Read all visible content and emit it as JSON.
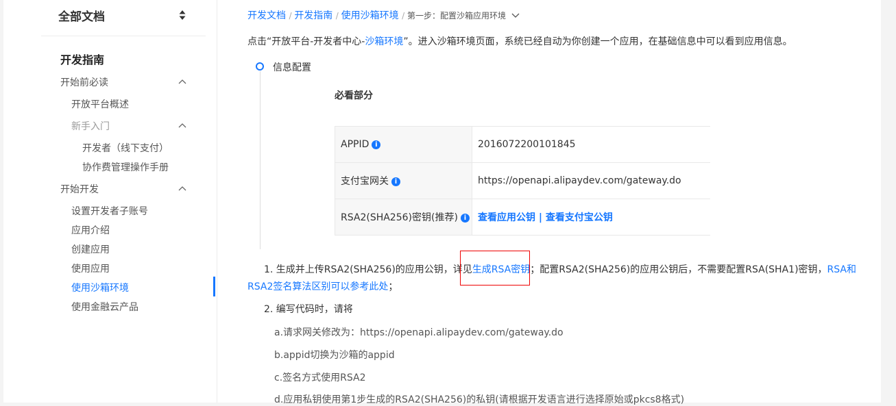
{
  "sidebar": {
    "header_title": "全部文档",
    "section_title": "开发指南",
    "items": [
      {
        "label": "开始前必读"
      },
      {
        "label": "开放平台概述"
      },
      {
        "label": "新手入门"
      },
      {
        "label": "开发者（线下支付）"
      },
      {
        "label": "协作费管理操作手册"
      },
      {
        "label": "开始开发"
      },
      {
        "label": "设置开发者子账号"
      },
      {
        "label": "应用介绍"
      },
      {
        "label": "创建应用"
      },
      {
        "label": "使用应用"
      },
      {
        "label": "使用沙箱环境"
      },
      {
        "label": "使用金融云产品"
      }
    ]
  },
  "breadcrumb": {
    "items": [
      "开发文档",
      "开发指南",
      "使用沙箱环境"
    ],
    "current": "第一步：配置沙箱应用环境"
  },
  "intro": {
    "before": "点击“开放平台-开发者中心-",
    "link": "沙箱环境",
    "after": "”。进入沙箱环境页面，系统已经自动为你创建一个应用，在基础信息中可以看到应用信息。"
  },
  "timeline": {
    "label": "信息配置"
  },
  "must_title": "必看部分",
  "table": {
    "rows": [
      {
        "key": "APPID",
        "value": "2016072200101845"
      },
      {
        "key": "支付宝网关",
        "value": "https://openapi.alipaydev.com/gateway.do"
      },
      {
        "key": "RSA2(SHA256)密钥(推荐)",
        "link1": "查看应用公钥",
        "separator": " | ",
        "link2": "查看支付宝公钥"
      }
    ]
  },
  "step1": {
    "prefix": "1. 生成并上传RSA2(SHA256)的应用公钥，详见",
    "link1": "生成RSA密钥",
    "middle": "；配置RSA2(SHA256)的应用公钥后，不需要配置RSA(SHA1)密钥，",
    "link2a": "RSA和",
    "link2b": "RSA2签名算法区别可以参考此处",
    "suffix": "；"
  },
  "step2": {
    "title": "2. 编写代码时，请将",
    "subs": [
      "a.请求网关修改为：https://openapi.alipaydev.com/gateway.do",
      "b.appid切换为沙箱的appid",
      "c.签名方式使用RSA2",
      "d.应用私钥使用第1步生成的RSA2(SHA256)的私钥(请根据开发语言进行选择原始或pkcs8格式)"
    ]
  },
  "colors": {
    "accent": "#1677ff",
    "highlight_box": "#e00000"
  }
}
